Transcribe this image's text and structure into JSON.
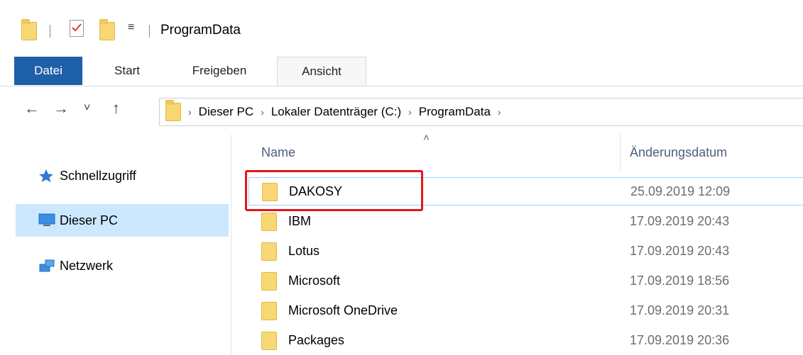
{
  "window": {
    "title": "ProgramData",
    "quick_access_dropdown": "≡"
  },
  "ribbon": {
    "tabs": [
      {
        "label": "Datei",
        "active": true
      },
      {
        "label": "Start"
      },
      {
        "label": "Freigeben"
      },
      {
        "label": "Ansicht"
      }
    ]
  },
  "nav": {
    "back": "←",
    "forward": "→",
    "recent": "˅",
    "up": "↑",
    "breadcrumb": [
      "Dieser PC",
      "Lokaler Datenträger (C:)",
      "ProgramData"
    ],
    "sep": "›"
  },
  "sidebar": {
    "items": [
      {
        "label": "Schnellzugriff",
        "icon": "star-icon"
      },
      {
        "label": "Dieser PC",
        "icon": "monitor-icon",
        "selected": true
      },
      {
        "label": "Netzwerk",
        "icon": "network-icon"
      }
    ]
  },
  "columns": {
    "name": "Name",
    "date": "Änderungsdatum",
    "sort_caret": "˄"
  },
  "files": [
    {
      "name": "DAKOSY",
      "date": "25.09.2019 12:09"
    },
    {
      "name": "IBM",
      "date": "17.09.2019 20:43"
    },
    {
      "name": "Lotus",
      "date": "17.09.2019 20:43"
    },
    {
      "name": "Microsoft",
      "date": "17.09.2019 18:56"
    },
    {
      "name": "Microsoft OneDrive",
      "date": "17.09.2019 20:31"
    },
    {
      "name": "Packages",
      "date": "17.09.2019 20:36"
    }
  ],
  "colors": {
    "accent": "#1e5fa9",
    "selection": "#cce8ff",
    "highlight": "#e8141b",
    "folder": "#f8d775"
  }
}
